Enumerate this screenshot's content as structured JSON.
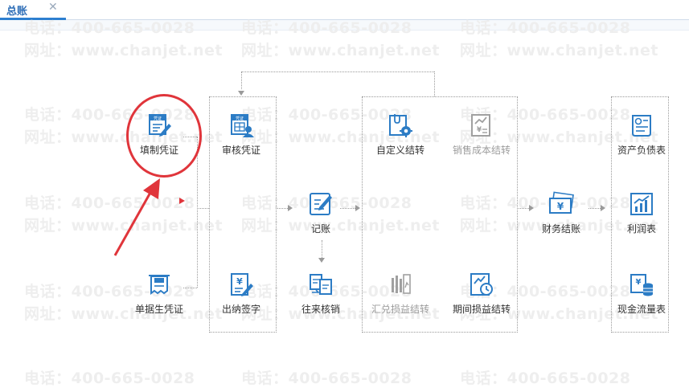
{
  "tab": {
    "label": "总账",
    "close": "✕"
  },
  "watermark": {
    "phone": "电话：400-665-0028",
    "url": "网址：www.chanjet.net"
  },
  "nodes": {
    "fill_voucher": "填制凭证",
    "doc_voucher": "单据生凭证",
    "audit_voucher": "审核凭证",
    "cashier_sign": "出纳签字",
    "post": "记账",
    "ar_ap_writeoff": "往来核销",
    "custom_transfer": "自定义结转",
    "sales_cost_transfer": "销售成本结转",
    "fx_gain_loss_transfer": "汇兑损益结转",
    "period_pl_transfer": "期间损益结转",
    "closing": "财务结账",
    "balance_sheet": "资产负债表",
    "income_statement": "利润表",
    "cash_flow_statement": "现金流量表"
  },
  "icon_text": {
    "voucher": "凭证",
    "yuan": "¥"
  },
  "colors": {
    "icon_blue": "#2c7cc5",
    "icon_grey": "#a0a0a0",
    "highlight_red": "#e0353b",
    "dotted_line": "#9a9a9a"
  }
}
